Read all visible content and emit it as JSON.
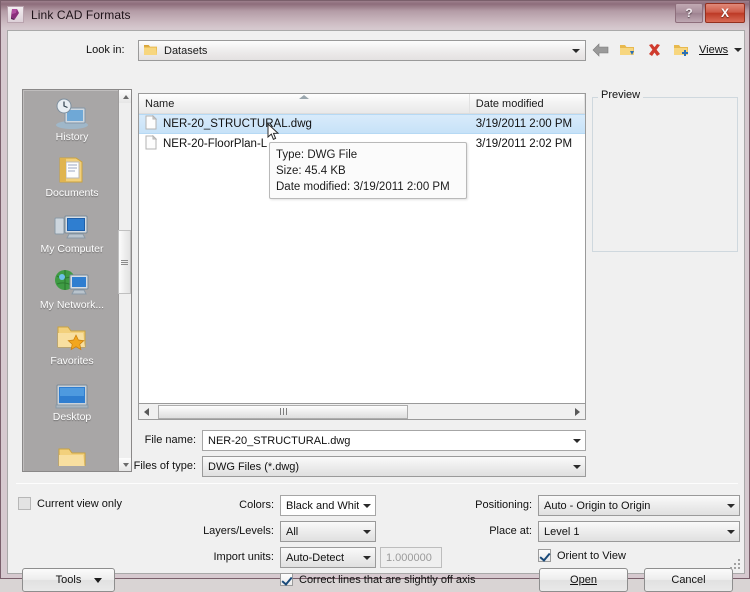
{
  "window": {
    "title": "Link CAD Formats",
    "icon": "revit-link-icon",
    "help_label": "?",
    "close_label": "X"
  },
  "lookin": {
    "label": "Look in:",
    "value": "Datasets",
    "icon": "folder-icon"
  },
  "toolbar": {
    "back_icon": "back-arrow-icon",
    "up_icon": "up-folder-icon",
    "delete_icon": "delete-x-icon",
    "newfolder_icon": "new-folder-icon",
    "views_label": "Views",
    "views_arrow": "chevron-down-icon"
  },
  "places": {
    "items": [
      {
        "label": "History",
        "icon": "history-icon"
      },
      {
        "label": "Documents",
        "icon": "documents-folder-icon"
      },
      {
        "label": "My Computer",
        "icon": "computer-icon"
      },
      {
        "label": "My Network...",
        "icon": "network-icon"
      },
      {
        "label": "Favorites",
        "icon": "favorites-star-folder-icon"
      },
      {
        "label": "Desktop",
        "icon": "desktop-icon"
      },
      {
        "label": "",
        "icon": "folder-icon"
      }
    ]
  },
  "filelist": {
    "columns": [
      {
        "key": "name",
        "label": "Name",
        "sorted": "ascending"
      },
      {
        "key": "date",
        "label": "Date modified"
      }
    ],
    "rows": [
      {
        "name": "NER-20_STRUCTURAL.dwg",
        "date": "3/19/2011 2:00 PM",
        "selected": true,
        "icon": "file-icon"
      },
      {
        "name": "NER-20-FloorPlan-L",
        "date": "3/19/2011 2:02 PM",
        "selected": false,
        "icon": "file-icon"
      }
    ]
  },
  "tooltip": {
    "line1": "Type: DWG File",
    "line2": "Size: 45.4 KB",
    "line3": "Date modified: 3/19/2011 2:00 PM"
  },
  "preview": {
    "legend": "Preview"
  },
  "filename": {
    "label": "File name:",
    "value": "NER-20_STRUCTURAL.dwg"
  },
  "filetype": {
    "label": "Files of type:",
    "value": "DWG Files  (*.dwg)"
  },
  "options": {
    "current_view_only": {
      "label": "Current view only",
      "checked": false
    },
    "colors": {
      "label": "Colors:",
      "value": "Black and Whit"
    },
    "layers": {
      "label": "Layers/Levels:",
      "value": "All"
    },
    "import_units": {
      "label": "Import units:",
      "value": "Auto-Detect",
      "scale": "1.000000"
    },
    "positioning": {
      "label": "Positioning:",
      "value": "Auto - Origin to Origin"
    },
    "place_at": {
      "label": "Place at:",
      "value": "Level 1"
    },
    "orient_to_view": {
      "label": "Orient to View",
      "checked": true
    },
    "correct_lines": {
      "label": "Correct lines that are slightly off axis",
      "checked": true
    }
  },
  "buttons": {
    "tools": "Tools",
    "open": "Open",
    "cancel": "Cancel"
  },
  "colors": {
    "title_bar": "#a98c99",
    "selection": "#c7e2f8",
    "close_button": "#c0402b",
    "accent_folder": "#f0c060"
  }
}
